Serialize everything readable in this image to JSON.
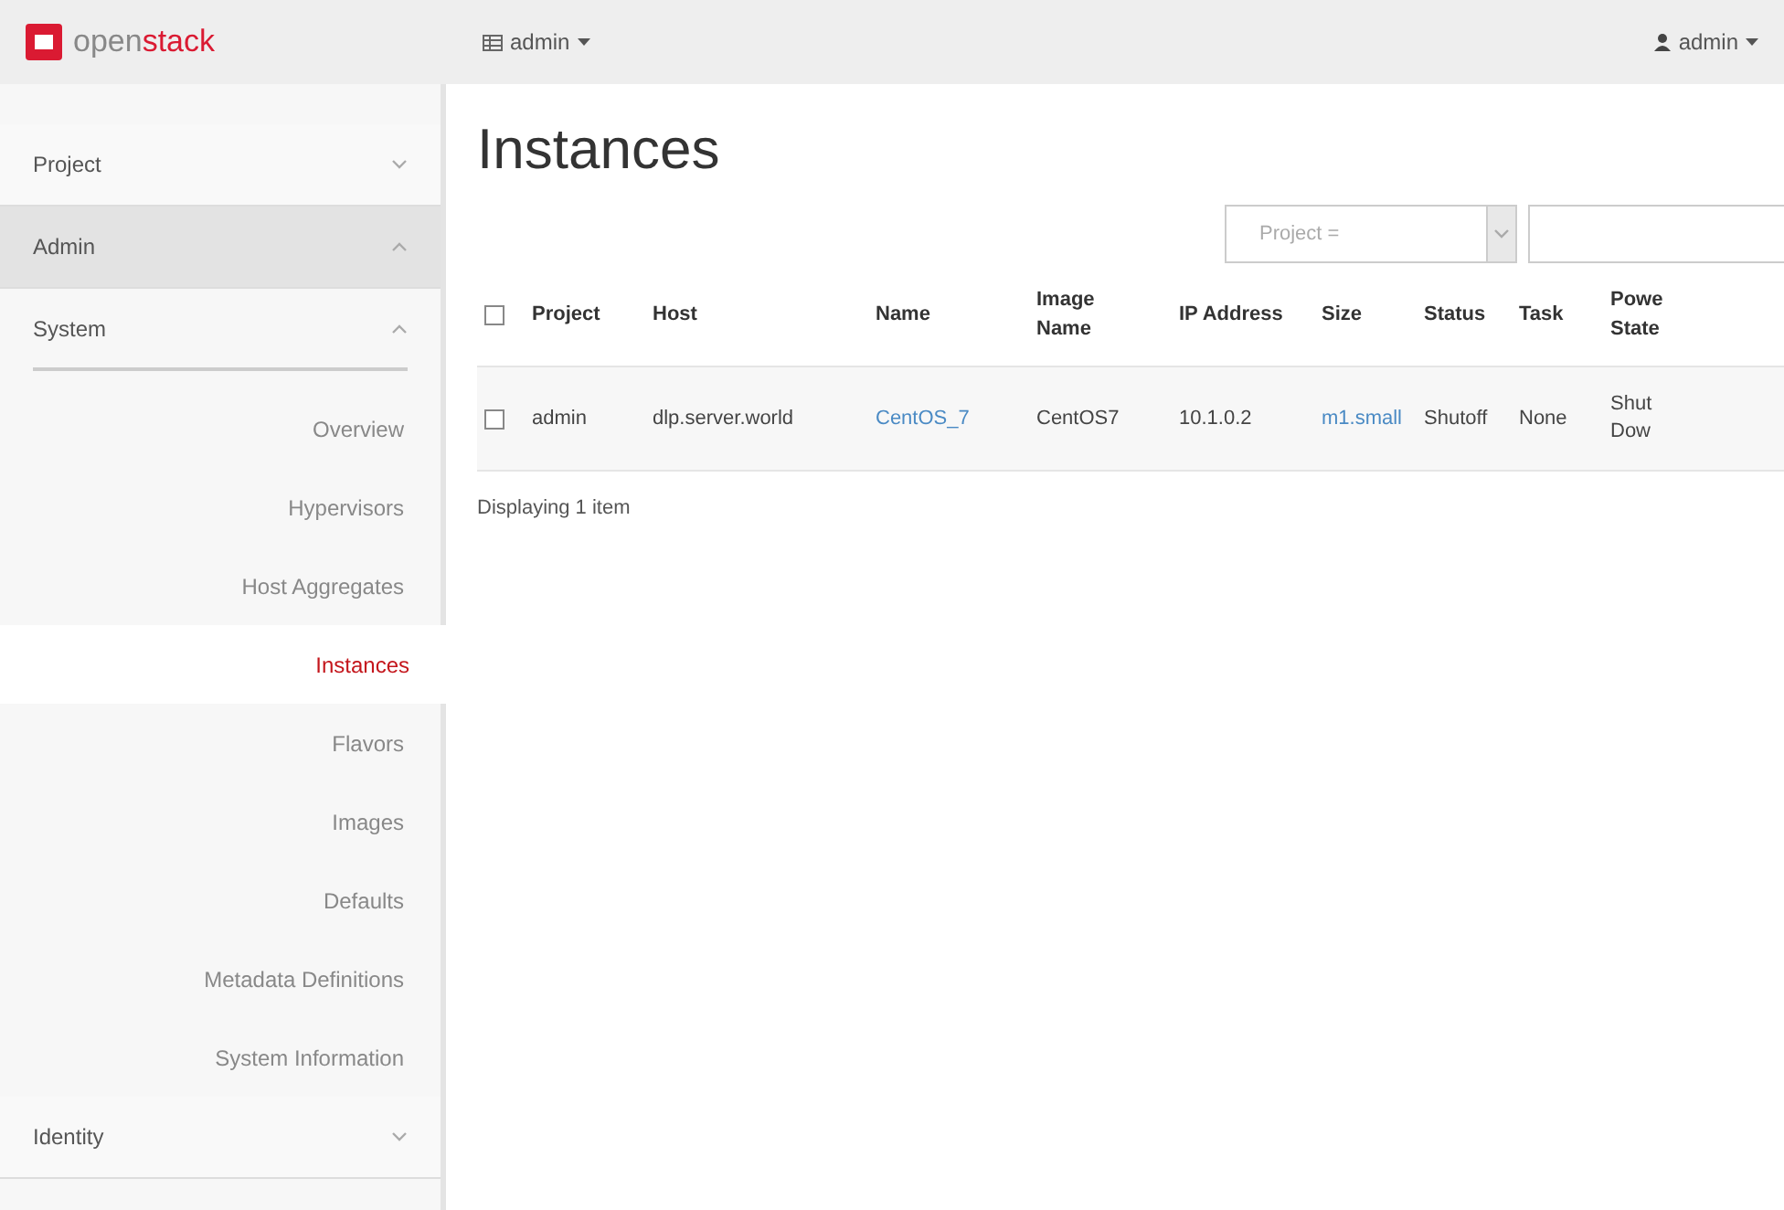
{
  "topbar": {
    "logo_text_1": "open",
    "logo_text_2": "stack",
    "project_menu": "admin",
    "user_menu": "admin"
  },
  "sidebar": [
    {
      "label": "Project",
      "expanded": false
    },
    {
      "label": "Admin",
      "expanded": true,
      "children": [
        {
          "label": "System",
          "expanded": true,
          "children": [
            {
              "label": "Overview",
              "selected": false
            },
            {
              "label": "Hypervisors",
              "selected": false
            },
            {
              "label": "Host Aggregates",
              "selected": false
            },
            {
              "label": "Instances",
              "selected": true
            },
            {
              "label": "Flavors",
              "selected": false
            },
            {
              "label": "Images",
              "selected": false
            },
            {
              "label": "Defaults",
              "selected": false
            },
            {
              "label": "Metadata Definitions",
              "selected": false
            },
            {
              "label": "System Information",
              "selected": false
            }
          ]
        }
      ]
    },
    {
      "label": "Identity",
      "expanded": false
    }
  ],
  "page_title": "Instances",
  "filter": {
    "select_value": "Project ="
  },
  "table": {
    "columns": [
      "Project",
      "Host",
      "Name",
      "Image Name",
      "IP Address",
      "Size",
      "Status",
      "Task",
      "Powe State"
    ],
    "rows": [
      {
        "checked": false,
        "cells": [
          {
            "text": "admin",
            "kind": "text"
          },
          {
            "text": "dlp.server.world",
            "kind": "text"
          },
          {
            "text": "CentOS_7",
            "kind": "link"
          },
          {
            "text": "CentOS7",
            "kind": "text"
          },
          {
            "text": "10.1.0.2",
            "kind": "text"
          },
          {
            "text": "m1.small",
            "kind": "link"
          },
          {
            "text": "Shutoff",
            "kind": "text"
          },
          {
            "text": "None",
            "kind": "text"
          },
          {
            "text": "Shut Dow",
            "kind": "text"
          }
        ]
      }
    ],
    "header_checked": false
  },
  "footer_text": "Displaying 1 item"
}
